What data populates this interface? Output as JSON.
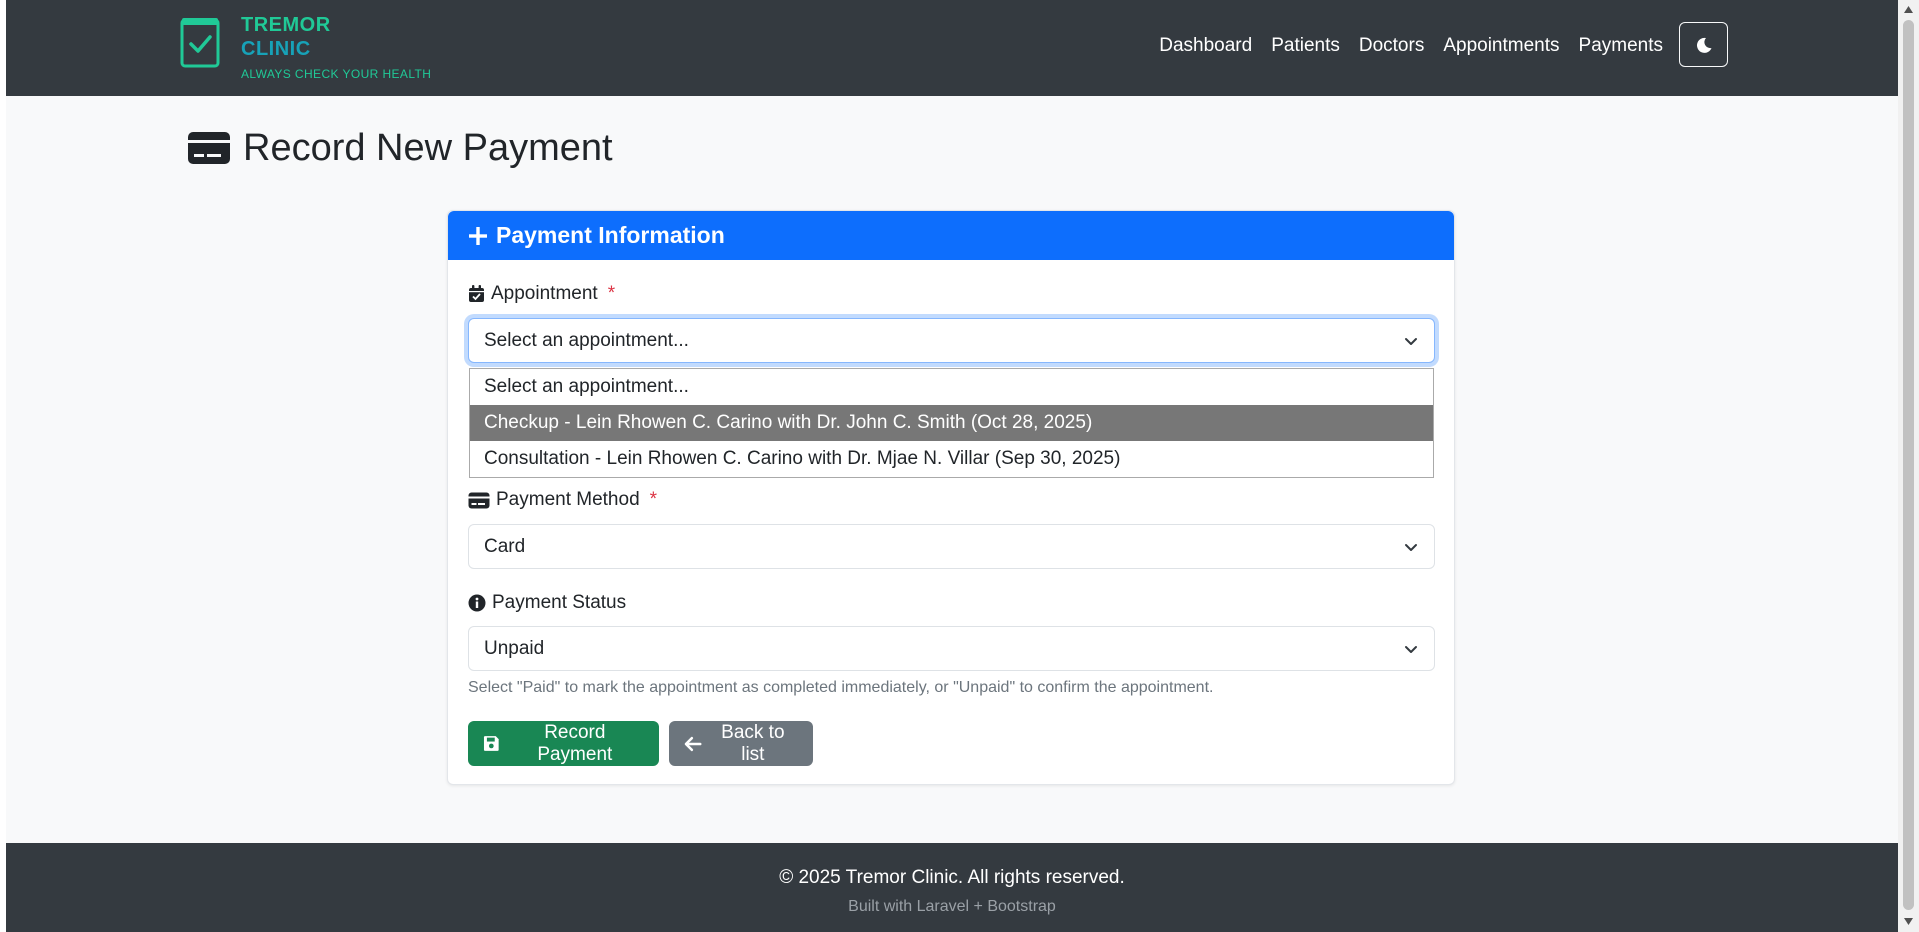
{
  "brand": {
    "name_line1": "TREMOR",
    "name_line2": "CLINIC",
    "tagline": "ALWAYS CHECK YOUR HEALTH",
    "colors": {
      "primary": "#20c997",
      "secondary": "#17a2b8"
    }
  },
  "nav": {
    "items": [
      "Dashboard",
      "Patients",
      "Doctors",
      "Appointments",
      "Payments"
    ],
    "theme_toggle_icon": "moon-icon"
  },
  "page": {
    "title": "Record New Payment",
    "title_icon": "credit-card-icon"
  },
  "card": {
    "header_title": "Payment Information",
    "header_icon": "plus-icon",
    "accent_color": "#0d6efd"
  },
  "form": {
    "appointment": {
      "label": "Appointment",
      "required_mark": "*",
      "selected": "Select an appointment...",
      "options": [
        "Select an appointment...",
        "Checkup - Lein Rhowen C. Carino with Dr. John C. Smith (Oct 28, 2025)",
        "Consultation - Lein Rhowen C. Carino with Dr. Mjae N. Villar (Sep 30, 2025)"
      ],
      "highlighted_option_index": 1
    },
    "payment_method": {
      "label": "Payment Method",
      "required_mark": "*",
      "selected": "Card"
    },
    "payment_status": {
      "label": "Payment Status",
      "selected": "Unpaid",
      "help": "Select \"Paid\" to mark the appointment as completed immediately, or \"Unpaid\" to confirm the appointment."
    },
    "buttons": {
      "submit": "Record Payment",
      "back": "Back to list"
    }
  },
  "footer": {
    "copyright": "© 2025 Tremor Clinic. All rights reserved.",
    "built_with": "Built with Laravel + Bootstrap"
  }
}
